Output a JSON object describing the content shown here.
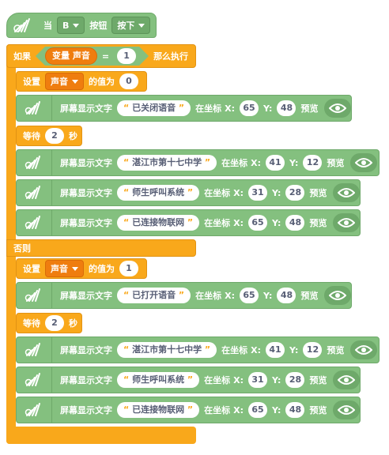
{
  "hat": {
    "prefix": "当",
    "key": "B",
    "key_label": "按钮",
    "state": "按下"
  },
  "if_block": {
    "if_label": "如果",
    "then_label": "那么执行",
    "else_label": "否则",
    "condition": {
      "var_label": "变量",
      "var_name": "声音",
      "operator": "=",
      "value": "1"
    }
  },
  "labels": {
    "set_prefix": "设置",
    "set_suffix": "的值为",
    "wait_prefix": "等待",
    "wait_suffix": "秒",
    "display_prefix": "屏幕显示文字",
    "at_coord": "在坐标",
    "x_label": "X:",
    "y_label": "Y:",
    "preview": "预览",
    "open_quote": "“",
    "close_quote": "”"
  },
  "then_branch": [
    {
      "type": "set",
      "var": "声音",
      "value": "0"
    },
    {
      "type": "display",
      "text": "已关闭语音",
      "x": "65",
      "y": "48"
    },
    {
      "type": "wait",
      "seconds": "2"
    },
    {
      "type": "display",
      "text": "湛江市第十七中学",
      "x": "41",
      "y": "12"
    },
    {
      "type": "display",
      "text": "师生呼叫系统",
      "x": "31",
      "y": "28"
    },
    {
      "type": "display",
      "text": "已连接物联网",
      "x": "65",
      "y": "48"
    }
  ],
  "else_branch": [
    {
      "type": "set",
      "var": "声音",
      "value": "1"
    },
    {
      "type": "display",
      "text": "已打开语音",
      "x": "65",
      "y": "48"
    },
    {
      "type": "wait",
      "seconds": "2"
    },
    {
      "type": "display",
      "text": "湛江市第十七中学",
      "x": "41",
      "y": "12"
    },
    {
      "type": "display",
      "text": "师生呼叫系统",
      "x": "31",
      "y": "28"
    },
    {
      "type": "display",
      "text": "已连接物联网",
      "x": "65",
      "y": "48"
    }
  ],
  "colors": {
    "display_block": "#84c07f",
    "control_block": "#f9a81b",
    "variable_block": "#ef7d0f"
  },
  "icons": {
    "display_icon": "robot-hand-icon",
    "preview_icon": "eye-icon"
  }
}
